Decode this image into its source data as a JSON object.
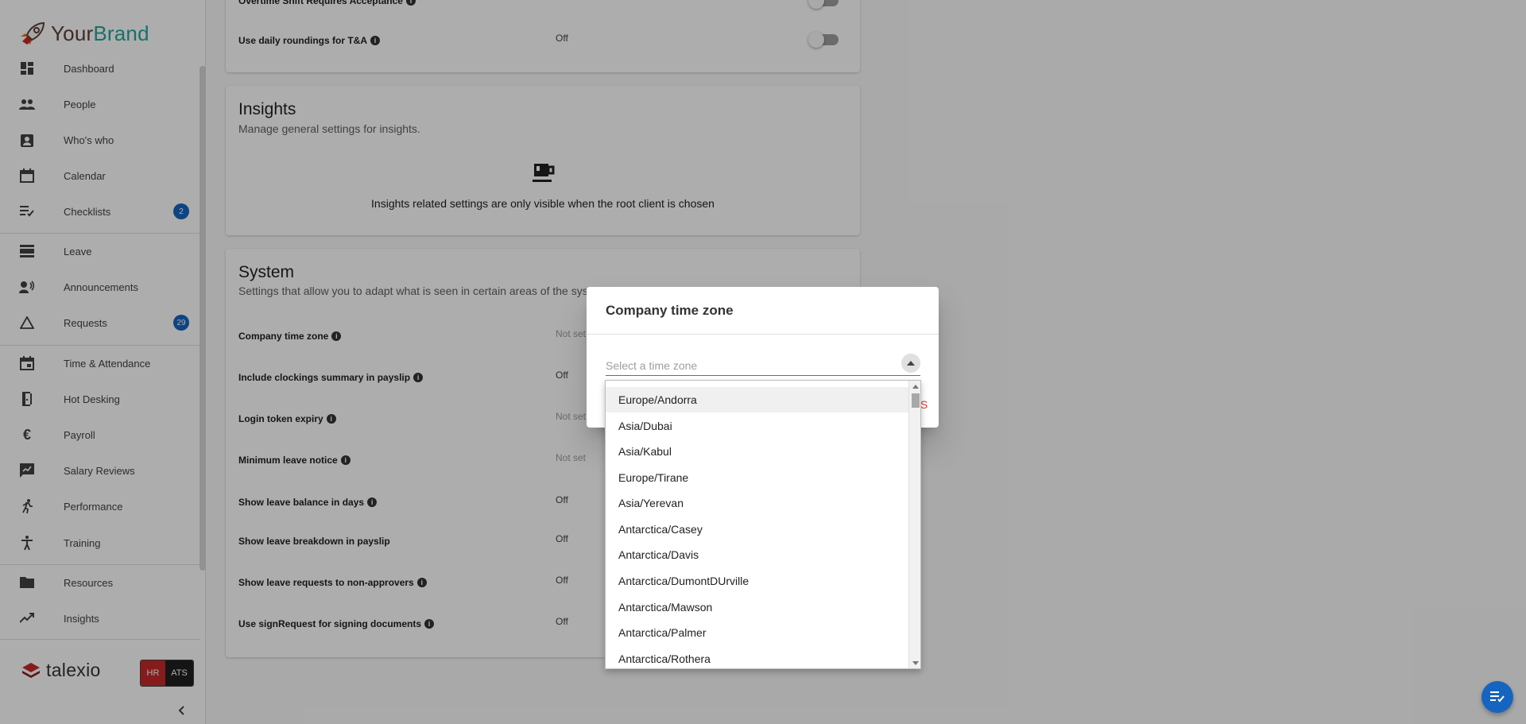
{
  "brand": {
    "part1": "Your",
    "part2": "Brand"
  },
  "sidebar": {
    "items": [
      {
        "label": "Dashboard",
        "icon": "dashboard-icon"
      },
      {
        "label": "People",
        "icon": "people-icon"
      },
      {
        "label": "Who's who",
        "icon": "contact-card-icon"
      },
      {
        "label": "Calendar",
        "icon": "calendar-icon"
      },
      {
        "label": "Checklists",
        "icon": "checklist-icon",
        "badge": "2"
      },
      {
        "label": "Leave",
        "icon": "leave-icon"
      },
      {
        "label": "Announcements",
        "icon": "announcement-icon"
      },
      {
        "label": "Requests",
        "icon": "triangle-icon",
        "badge": "29"
      },
      {
        "label": "Time & Attendance",
        "icon": "calendar-event-icon"
      },
      {
        "label": "Hot Desking",
        "icon": "door-icon"
      },
      {
        "label": "Payroll",
        "icon": "euro-icon"
      },
      {
        "label": "Salary Reviews",
        "icon": "review-icon"
      },
      {
        "label": "Performance",
        "icon": "running-icon"
      },
      {
        "label": "Training",
        "icon": "accessibility-icon"
      },
      {
        "label": "Resources",
        "icon": "folder-icon"
      },
      {
        "label": "Insights",
        "icon": "trending-icon"
      }
    ],
    "footer": {
      "logo": "talexio",
      "hr": "HR",
      "ats": "ATS"
    }
  },
  "top_card": {
    "rows": [
      {
        "label": "Overtime Shift Requires Acceptance",
        "value": ""
      },
      {
        "label": "Use daily roundings for T&A",
        "value": "Off"
      }
    ]
  },
  "insights": {
    "title": "Insights",
    "subtitle": "Manage general settings for insights.",
    "message": "Insights related settings are only visible when the root client is chosen"
  },
  "system": {
    "title": "System",
    "subtitle": "Settings that allow you to adapt what is seen in certain areas of the sys",
    "rows": [
      {
        "label": "Company time zone",
        "value": "Not set"
      },
      {
        "label": "Include clockings summary in payslip",
        "value": "Off"
      },
      {
        "label": "Login token expiry",
        "value": "Not set"
      },
      {
        "label": "Minimum leave notice",
        "value": "Not set"
      },
      {
        "label": "Show leave balance in days",
        "value": "Off"
      },
      {
        "label": "Show leave breakdown in payslip",
        "value": "Off"
      },
      {
        "label": "Show leave requests to non-approvers",
        "value": "Off"
      },
      {
        "label": "Use signRequest for signing documents",
        "value": "Off"
      }
    ]
  },
  "dialog": {
    "title": "Company time zone",
    "select_placeholder": "Select a time zone",
    "partial_action": "S",
    "options": [
      "Europe/Andorra",
      "Asia/Dubai",
      "Asia/Kabul",
      "Europe/Tirane",
      "Asia/Yerevan",
      "Antarctica/Casey",
      "Antarctica/Davis",
      "Antarctica/DumontDUrville",
      "Antarctica/Mawson",
      "Antarctica/Palmer",
      "Antarctica/Rothera"
    ]
  },
  "colors": {
    "accent": "#1565c0",
    "error": "#e53935",
    "brand_teal": "#26a69a"
  }
}
